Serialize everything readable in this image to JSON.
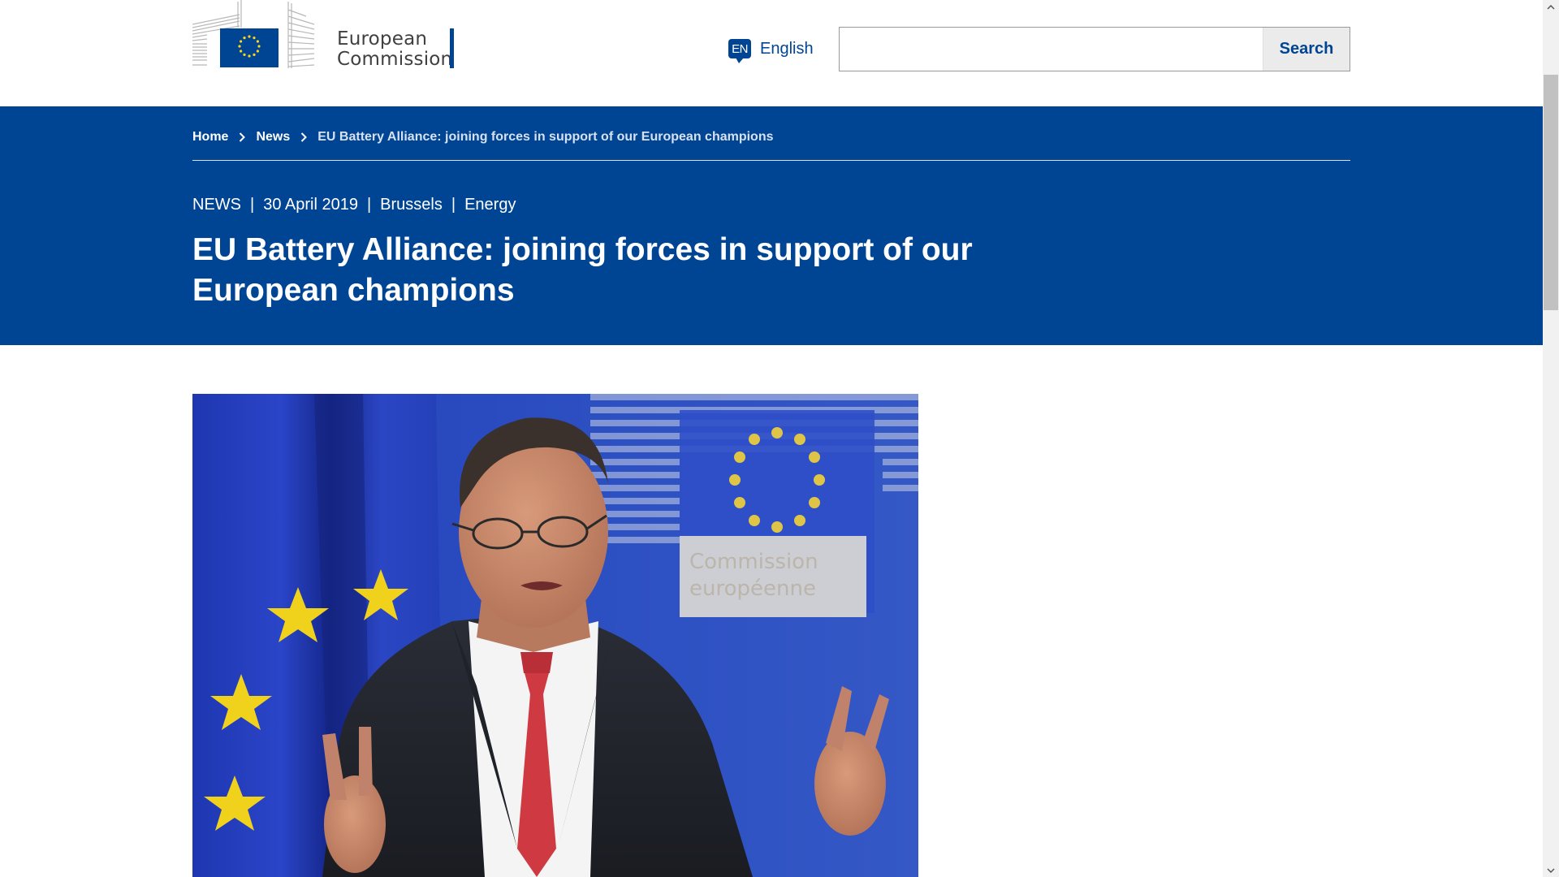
{
  "colors": {
    "brand_blue": "#004494",
    "eu_yellow": "#ffd617",
    "search_button_bg": "#ebebeb",
    "text": "#404040"
  },
  "header": {
    "logo": {
      "icon": "european-commission-logo",
      "line1": "European",
      "line2": "Commission"
    },
    "language": {
      "badge": "EN",
      "label": "English",
      "icon": "speech-bubble-icon"
    },
    "search": {
      "value": "",
      "placeholder": "",
      "button_label": "Search"
    }
  },
  "breadcrumb": {
    "items": [
      {
        "label": "Home"
      },
      {
        "label": "News"
      }
    ],
    "current": "EU Battery Alliance: joining forces in support of our European champions",
    "separator_icon": "chevron-right-icon"
  },
  "article": {
    "meta": {
      "type": "NEWS",
      "date": "30 April 2019",
      "location": "Brussels",
      "topic": "Energy",
      "separator": "|"
    },
    "title": "EU Battery Alliance: joining forces in support of our European champions",
    "image": {
      "subject": "photo-of-speaker-at-european-commission-press-room",
      "backdrop_text": "Commission européenne"
    }
  }
}
